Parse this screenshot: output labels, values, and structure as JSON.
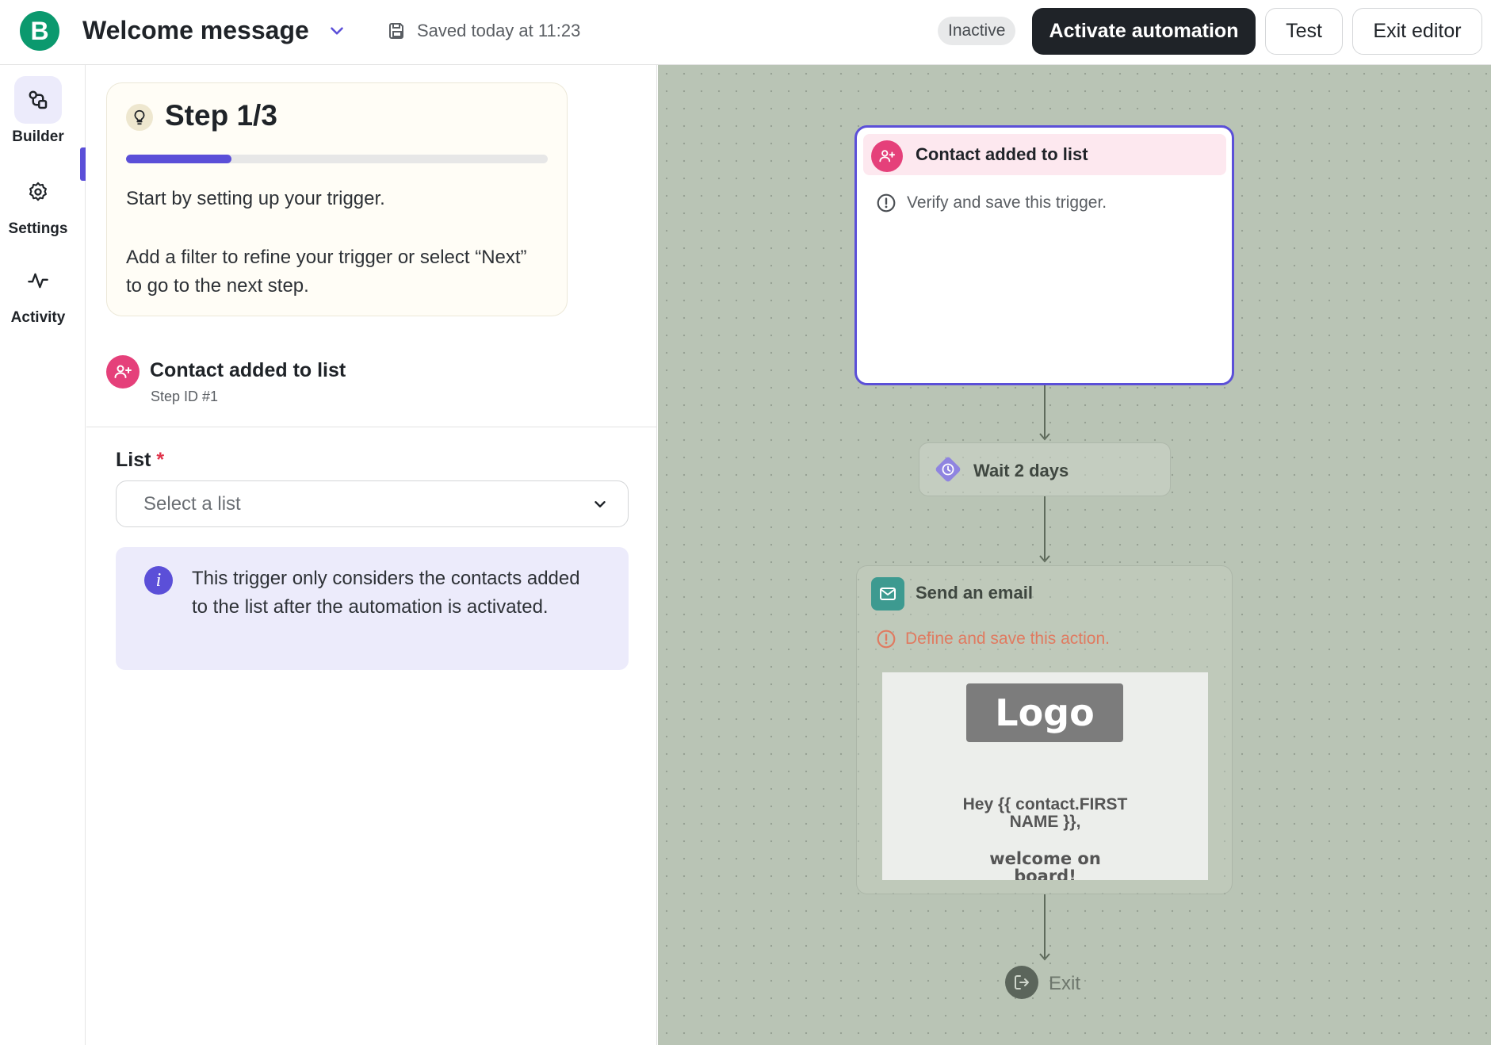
{
  "header": {
    "logo_letter": "B",
    "title": "Welcome message",
    "saved_text": "Saved today at 11:23",
    "status": "Inactive",
    "activate_label": "Activate automation",
    "test_label": "Test",
    "exit_label": "Exit editor"
  },
  "nav": {
    "items": [
      {
        "label": "Builder",
        "icon": "builder-icon",
        "active": true
      },
      {
        "label": "Settings",
        "icon": "gear-icon",
        "active": false
      },
      {
        "label": "Activity",
        "icon": "activity-icon",
        "active": false
      }
    ]
  },
  "step_card": {
    "title": "Step 1/3",
    "progress": 0.25,
    "text1": "Start by setting up your trigger.",
    "text2": "Add a filter to refine your trigger or select “Next” to go to the next step."
  },
  "trigger": {
    "title": "Contact added to list",
    "step_id": "Step ID #1"
  },
  "list_field": {
    "label": "List",
    "required_mark": "*",
    "placeholder": "Select a list"
  },
  "info": {
    "icon_letter": "i",
    "text": "This trigger only considers the contacts added to the list after the automation is activated."
  },
  "canvas": {
    "trigger_node": {
      "title": "Contact added to list",
      "warning": "Verify and save this trigger."
    },
    "wait_node": {
      "label": "Wait 2 days"
    },
    "email_node": {
      "title": "Send an email",
      "warning": "Define and save this action.",
      "preview_logo": "Logo",
      "preview_greeting": "Hey {{ contact.FIRSTNAME }},",
      "preview_welcome": "welcome on board!"
    },
    "exit_node": {
      "label": "Exit"
    }
  },
  "colors": {
    "accent": "#5b4fd8",
    "brand": "#0b996e",
    "trigger_pink": "#e5407a",
    "email_teal": "#3d9a90",
    "warning_orange": "#e07a60",
    "canvas_bg": "#b9c4b5"
  }
}
